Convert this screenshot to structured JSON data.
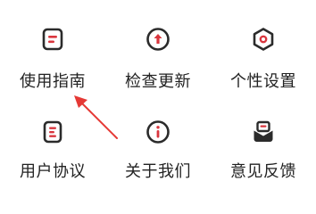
{
  "menu": {
    "items": [
      {
        "label": "使用指南",
        "icon": "guide-document-icon"
      },
      {
        "label": "检查更新",
        "icon": "update-arrow-icon"
      },
      {
        "label": "个性设置",
        "icon": "settings-hexagon-icon"
      },
      {
        "label": "用户协议",
        "icon": "agreement-document-icon"
      },
      {
        "label": "关于我们",
        "icon": "info-circle-icon"
      },
      {
        "label": "意见反馈",
        "icon": "feedback-mail-icon"
      }
    ]
  },
  "colors": {
    "icon_stroke": "#2b2b2b",
    "icon_accent": "#d9363e",
    "text": "#222222",
    "annotation_arrow": "#e53935"
  },
  "annotation": {
    "type": "arrow",
    "target": "使用指南"
  }
}
